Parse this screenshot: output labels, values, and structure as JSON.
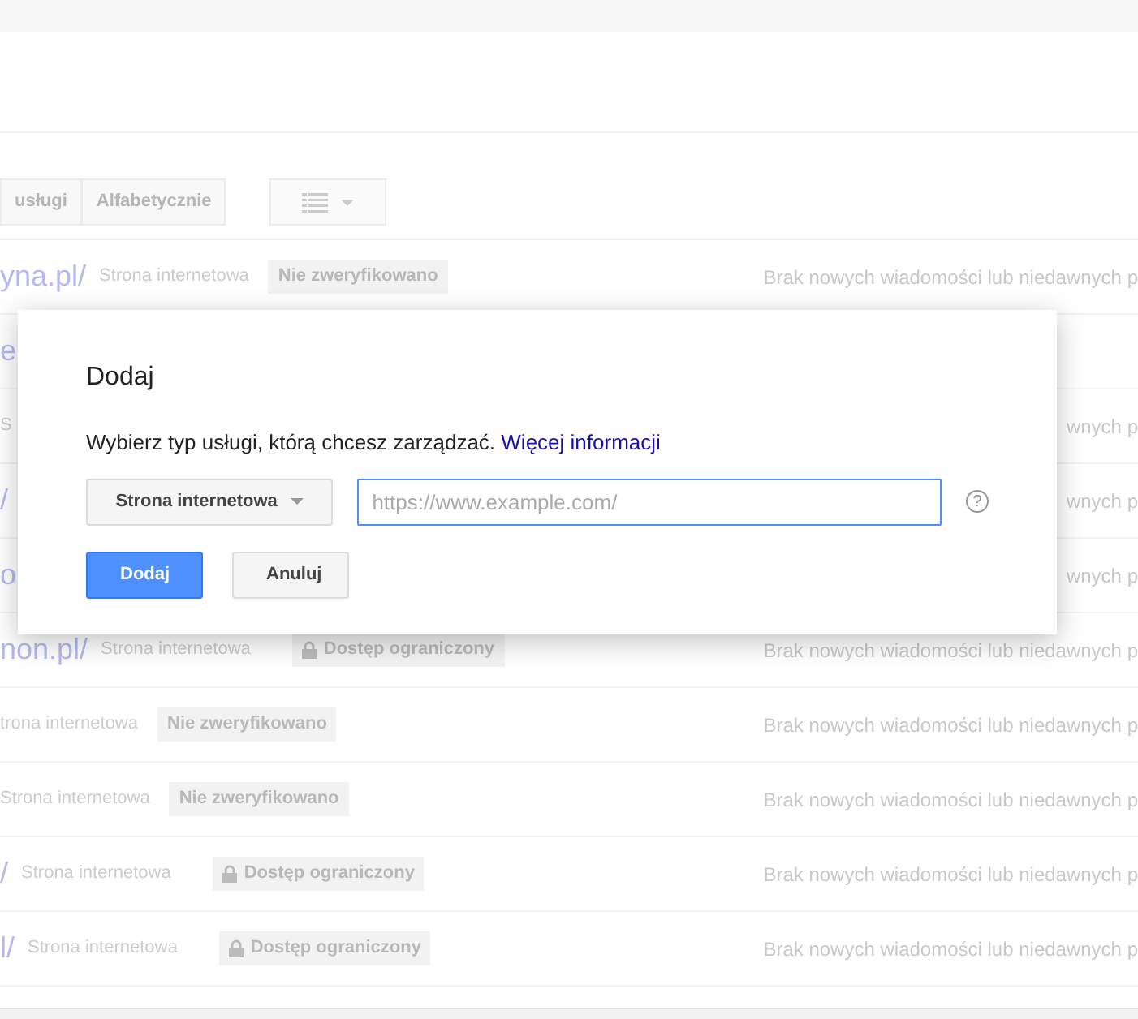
{
  "toolbar": {
    "sort_buttons": [
      {
        "label": "usługi"
      },
      {
        "label": "Alfabetycznie"
      }
    ]
  },
  "rows": [
    {
      "url": "yna.pl/",
      "type": "Strona internetowa",
      "status": {
        "kind": "unverified",
        "label": "Nie zweryfikowano"
      },
      "message": "Brak nowych wiadomości lub niedawnych p"
    },
    {
      "url": "e"
    },
    {
      "type": "S",
      "message": "wnych p"
    },
    {
      "url": "/",
      "message": "wnych p"
    },
    {
      "url": "o",
      "message": "wnych p"
    },
    {
      "url": "non.pl/",
      "type": "Strona internetowa",
      "status": {
        "kind": "restricted",
        "label": "Dostęp ograniczony"
      },
      "message": "Brak nowych wiadomości lub niedawnych p"
    },
    {
      "type": "trona internetowa",
      "status": {
        "kind": "unverified",
        "label": "Nie zweryfikowano"
      },
      "message": "Brak nowych wiadomości lub niedawnych p"
    },
    {
      "type": "Strona internetowa",
      "status": {
        "kind": "unverified",
        "label": "Nie zweryfikowano"
      },
      "message": "Brak nowych wiadomości lub niedawnych p"
    },
    {
      "url": "/",
      "type": "Strona internetowa",
      "status": {
        "kind": "restricted",
        "label": "Dostęp ograniczony"
      },
      "message": "Brak nowych wiadomości lub niedawnych p"
    },
    {
      "url": "l/",
      "type": "Strona internetowa",
      "status": {
        "kind": "restricted",
        "label": "Dostęp ograniczony"
      },
      "message": "Brak nowych wiadomości lub niedawnych p"
    }
  ],
  "dialog": {
    "title": "Dodaj",
    "text": "Wybierz typ usługi, którą chcesz zarządzać.",
    "link": "Więcej informacji",
    "type_dropdown": "Strona internetowa",
    "url_field": {
      "placeholder": "https://www.example.com/",
      "focused": true
    },
    "help": "?",
    "buttons": [
      {
        "kind": "primary",
        "label": "Dodaj"
      },
      {
        "kind": "secondary",
        "label": "Anuluj"
      }
    ]
  }
}
